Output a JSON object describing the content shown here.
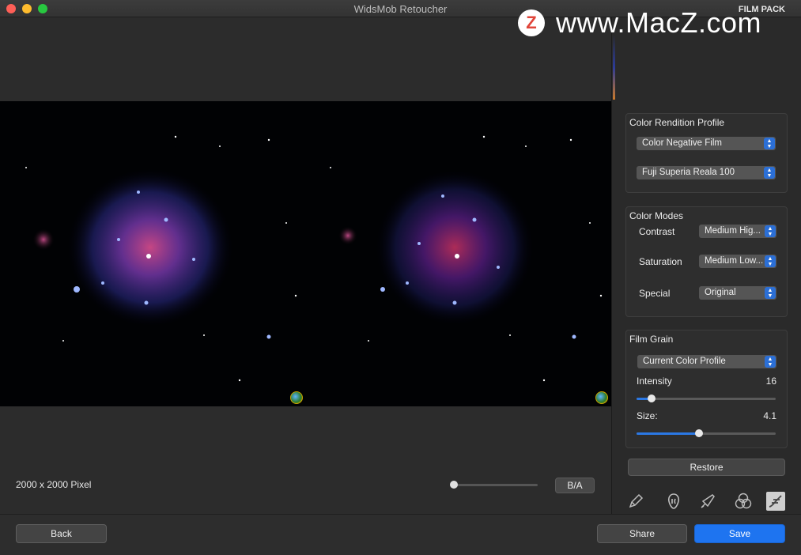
{
  "window": {
    "title": "WidsMob Retoucher",
    "mode_label": "FILM PACK"
  },
  "watermark": {
    "logo_letter": "Z",
    "text": "www.MacZ.com"
  },
  "canvas": {
    "size_label": "2000 x 2000 Pixel",
    "ba_label": "B/A",
    "zoom_fraction": 0.0
  },
  "color_rendition": {
    "title": "Color Rendition Profile",
    "profile": "Color Negative Film",
    "film": "Fuji Superia Reala 100"
  },
  "color_modes": {
    "title": "Color Modes",
    "contrast_label": "Contrast",
    "contrast_value": "Medium Hig...",
    "saturation_label": "Saturation",
    "saturation_value": "Medium Low...",
    "special_label": "Special",
    "special_value": "Original"
  },
  "film_grain": {
    "title": "Film Grain",
    "profile": "Current Color Profile",
    "intensity_label": "Intensity",
    "intensity_value": "16",
    "size_label": "Size:",
    "size_value": "4.1"
  },
  "restore_label": "Restore",
  "tools": [
    "pencil-icon",
    "face-icon",
    "brush-icon",
    "color-circles-icon",
    "film-icon"
  ],
  "footer": {
    "back": "Back",
    "share": "Share",
    "save": "Save"
  },
  "colors": {
    "accent": "#1e74f0",
    "slider_fill": "#2b78e4"
  }
}
